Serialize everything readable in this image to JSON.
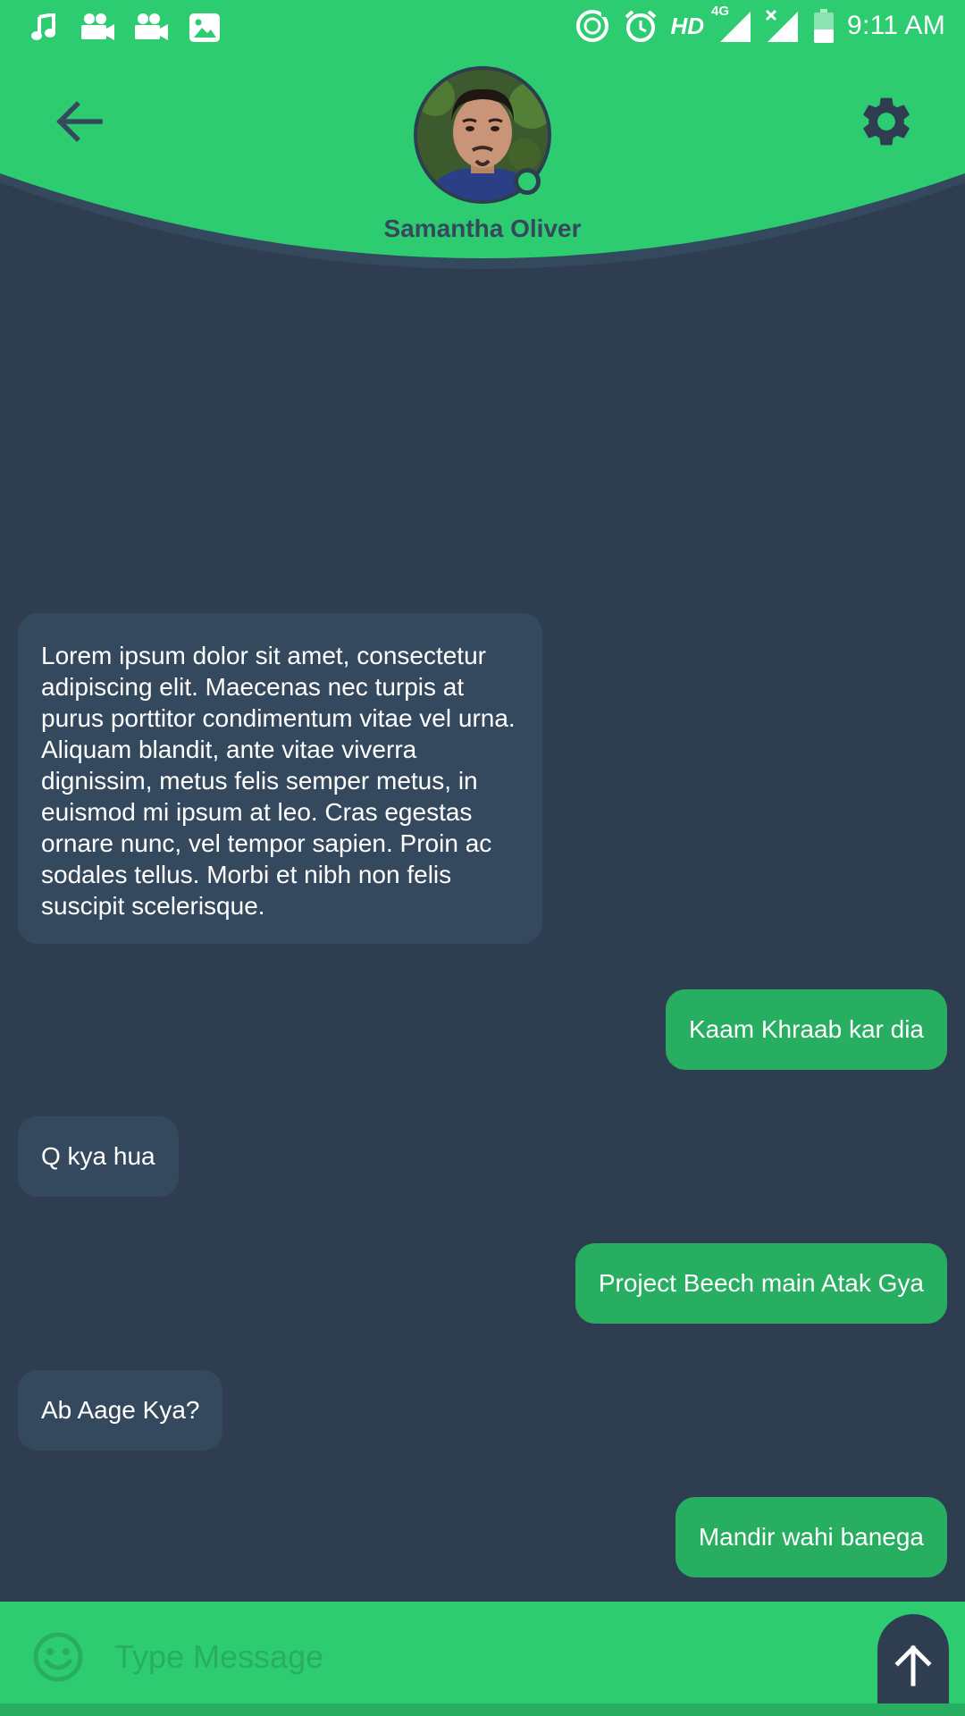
{
  "status_bar": {
    "left_icons": [
      "music-note-icon",
      "video-camera-icon",
      "video-camera-icon",
      "image-icon"
    ],
    "right_icons": [
      "data-saver-icon",
      "alarm-icon",
      "hd-icon",
      "signal-4g-icon",
      "signal-no-data-icon",
      "battery-icon"
    ],
    "hd_label": "HD",
    "network_label": "4G",
    "time": "9:11 AM"
  },
  "header": {
    "contact_name": "Samantha Oliver",
    "back_icon": "arrow-left-icon",
    "settings_icon": "gear-icon",
    "online": true
  },
  "messages": [
    {
      "direction": "incoming",
      "text": "Lorem ipsum dolor sit amet, consectetur adipiscing elit. Maecenas nec turpis at purus porttitor condimentum vitae vel urna. Aliquam blandit, ante vitae viverra dignissim, metus felis semper metus, in euismod mi ipsum at leo. Cras egestas ornare nunc, vel tempor sapien. Proin ac sodales tellus. Morbi et nibh non felis suscipit scelerisque."
    },
    {
      "direction": "outgoing",
      "text": "Kaam Khraab kar dia"
    },
    {
      "direction": "incoming",
      "text": "Q kya hua"
    },
    {
      "direction": "outgoing",
      "text": "Project Beech main Atak Gya"
    },
    {
      "direction": "incoming",
      "text": "Ab Aage Kya?"
    },
    {
      "direction": "outgoing",
      "text": "Mandir wahi banega"
    }
  ],
  "composer": {
    "placeholder": "Type Message",
    "value": "",
    "emoji_icon": "smiley-face-icon",
    "send_icon": "arrow-up-icon"
  },
  "colors": {
    "primary_green": "#2ecc71",
    "outgoing_bubble": "#27ae60",
    "background": "#2e3e50",
    "incoming_bubble": "#34495e"
  }
}
